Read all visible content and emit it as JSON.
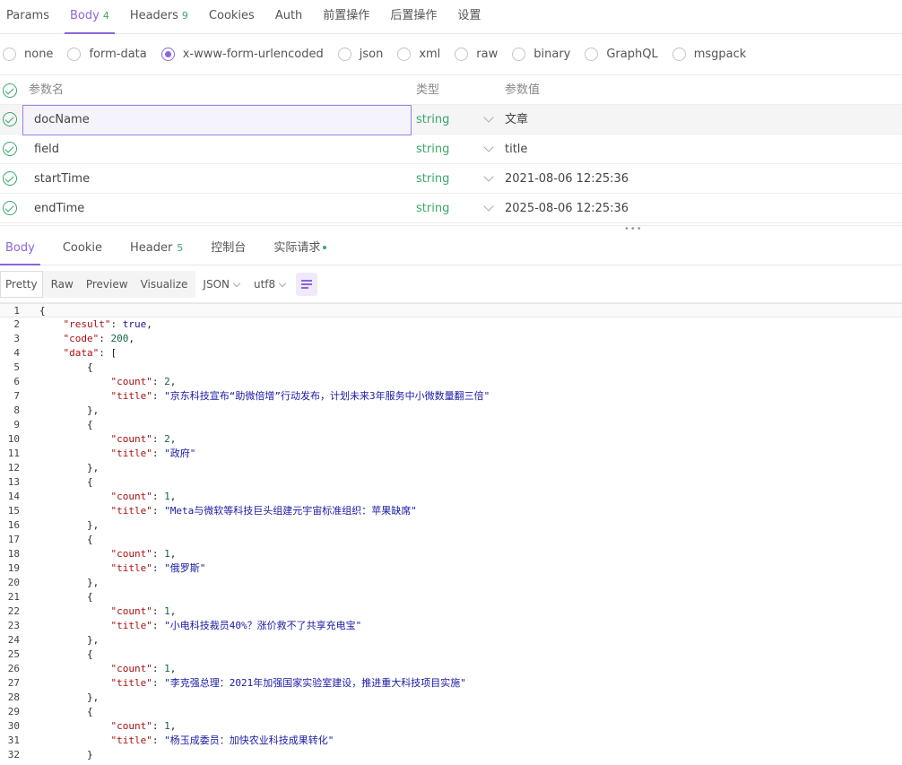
{
  "request_tabs": [
    {
      "label": "Params",
      "count": ""
    },
    {
      "label": "Body",
      "count": "4"
    },
    {
      "label": "Headers",
      "count": "9"
    },
    {
      "label": "Cookies",
      "count": ""
    },
    {
      "label": "Auth",
      "count": ""
    },
    {
      "label": "前置操作",
      "count": ""
    },
    {
      "label": "后置操作",
      "count": ""
    },
    {
      "label": "设置",
      "count": ""
    }
  ],
  "body_types": [
    "none",
    "form-data",
    "x-www-form-urlencoded",
    "json",
    "xml",
    "raw",
    "binary",
    "GraphQL",
    "msgpack"
  ],
  "params": {
    "header": {
      "name": "参数名",
      "type": "类型",
      "value": "参数值"
    },
    "rows": [
      {
        "name": "docName",
        "type": "string",
        "value": "文章"
      },
      {
        "name": "field",
        "type": "string",
        "value": "title"
      },
      {
        "name": "startTime",
        "type": "string",
        "value": "2021-08-06 12:25:36"
      },
      {
        "name": "endTime",
        "type": "string",
        "value": "2025-08-06 12:25:36"
      }
    ]
  },
  "resizer_grip": "•••",
  "response_tabs": [
    {
      "label": "Body",
      "count": ""
    },
    {
      "label": "Cookie",
      "count": ""
    },
    {
      "label": "Header",
      "count": "5"
    },
    {
      "label": "控制台",
      "count": ""
    },
    {
      "label": "实际请求",
      "count": ""
    }
  ],
  "format": {
    "modes": [
      "Pretty",
      "Raw",
      "Preview",
      "Visualize"
    ],
    "language": "JSON",
    "encoding": "utf8"
  },
  "code_lines": [
    "{",
    "    \"result\": true,",
    "    \"code\": 200,",
    "    \"data\": [",
    "        {",
    "            \"count\": 2,",
    "            \"title\": \"京东科技宣布“助微倍增”行动发布，计划未来3年服务中小微数量翻三倍\"",
    "        },",
    "        {",
    "            \"count\": 2,",
    "            \"title\": \"政府\"",
    "        },",
    "        {",
    "            \"count\": 1,",
    "            \"title\": \"Meta与微软等科技巨头组建元宇宙标准组织：苹果缺席\"",
    "        },",
    "        {",
    "            \"count\": 1,",
    "            \"title\": \"俄罗斯\"",
    "        },",
    "        {",
    "            \"count\": 1,",
    "            \"title\": \"小电科技裁员40%？涨价救不了共享充电宝\"",
    "        },",
    "        {",
    "            \"count\": 1,",
    "            \"title\": \"李克强总理：2021年加强国家实验室建设，推进重大科技项目实施\"",
    "        },",
    "        {",
    "            \"count\": 1,",
    "            \"title\": \"杨玉成委员：加快农业科技成果转化\"",
    "        }"
  ],
  "colors": {
    "accent": "#8c66d8",
    "success": "#3aa86a"
  }
}
